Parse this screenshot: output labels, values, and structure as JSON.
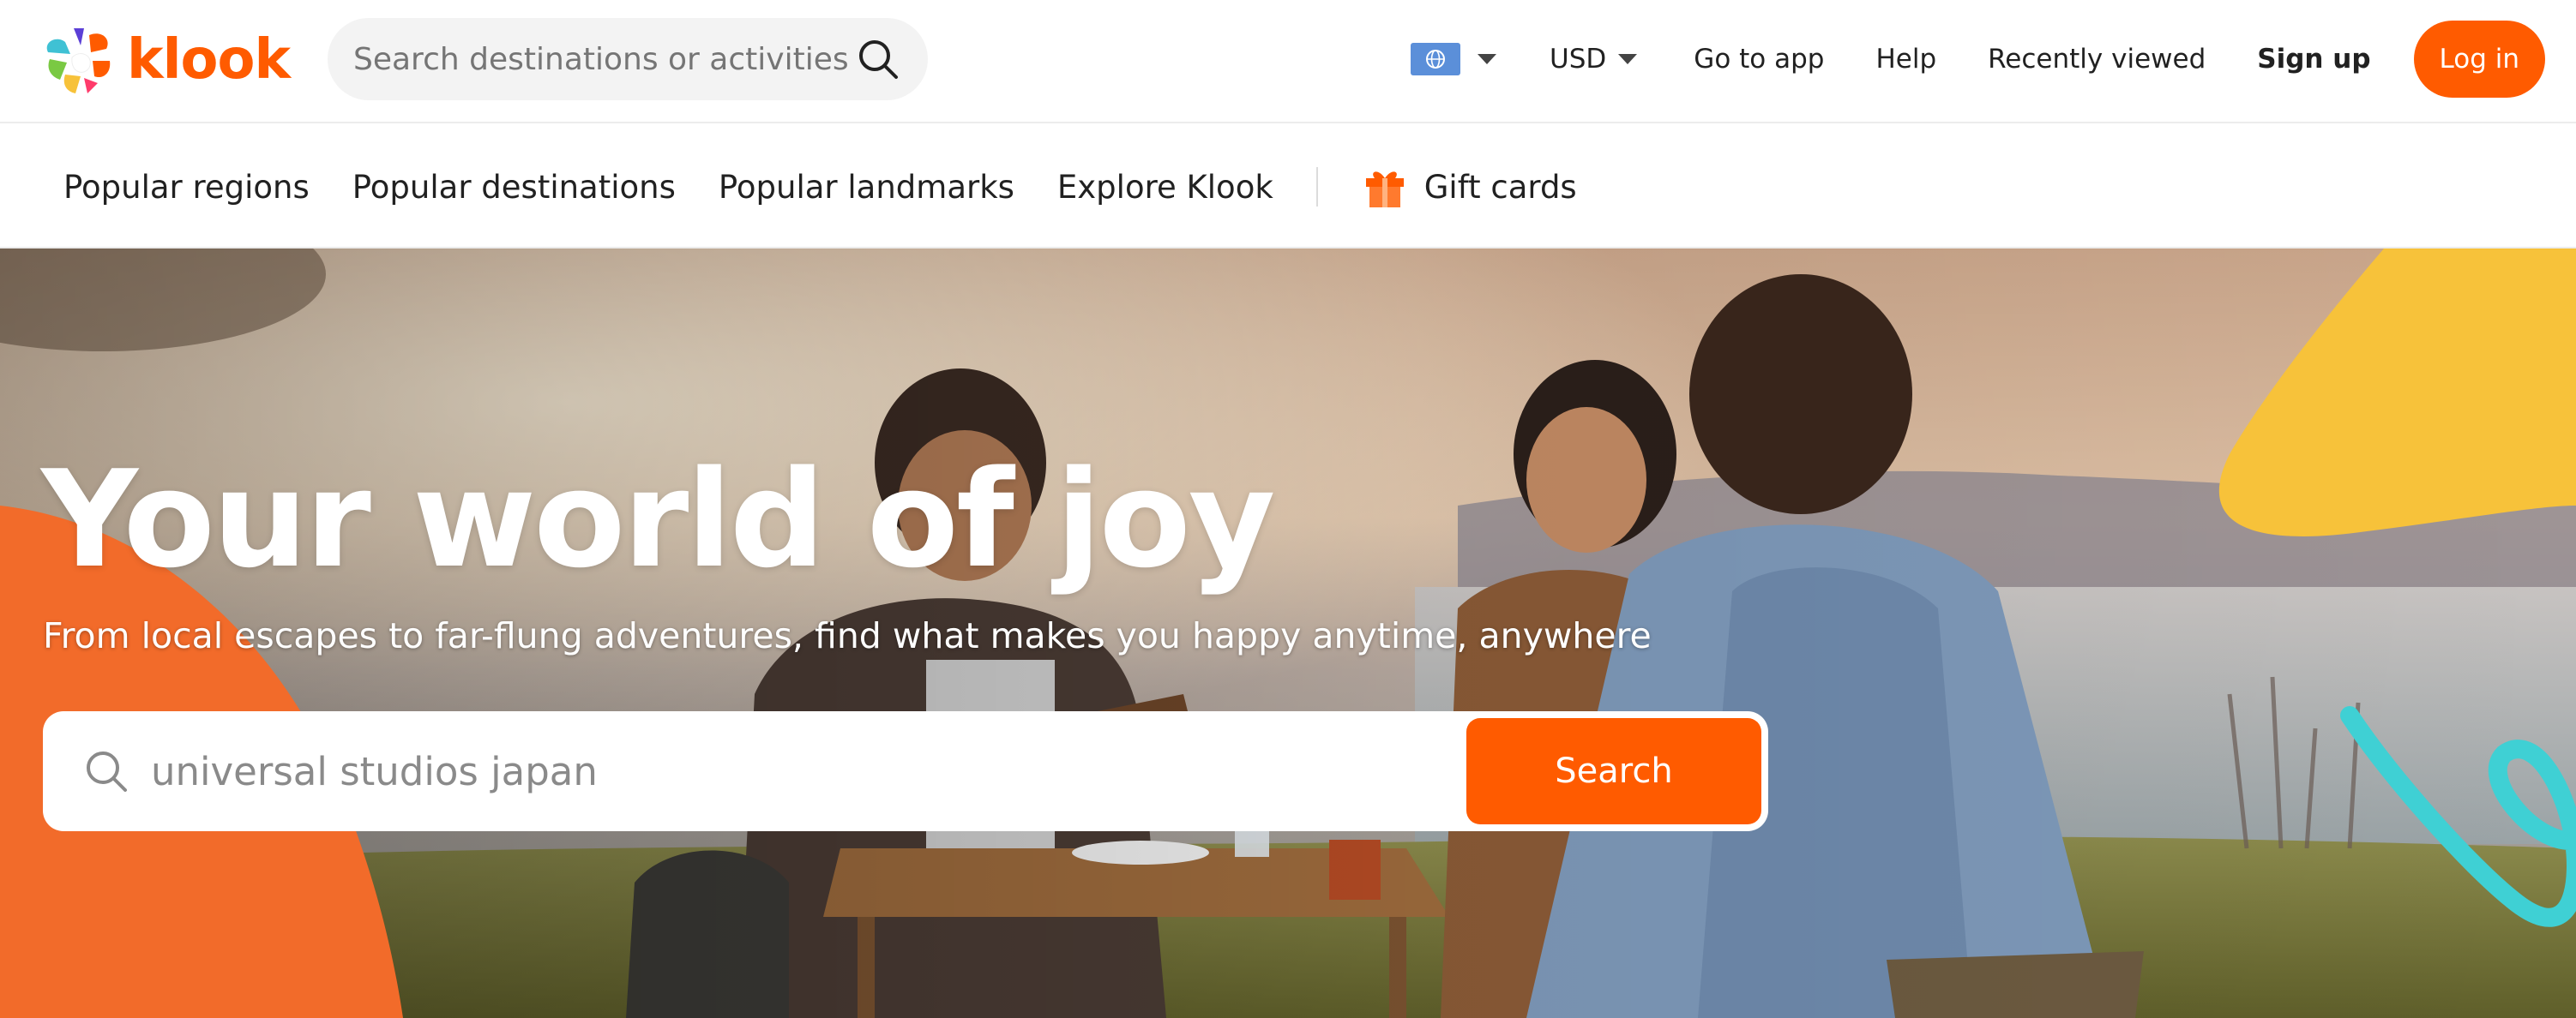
{
  "brand": {
    "name": "klook",
    "accent_color": "#ff5b00"
  },
  "header": {
    "search_placeholder": "Search destinations or activities",
    "language_icon": "globe-flag-icon",
    "currency": "USD",
    "links": {
      "go_to_app": "Go to app",
      "help": "Help",
      "recently_viewed": "Recently viewed",
      "sign_up": "Sign up"
    },
    "login_label": "Log in"
  },
  "subnav": {
    "items": [
      "Popular regions",
      "Popular destinations",
      "Popular landmarks",
      "Explore Klook"
    ],
    "gift_cards": "Gift cards"
  },
  "hero": {
    "title": "Your world of joy",
    "subtitle": "From local escapes to far-flung adventures, find what makes you happy anytime, anywhere",
    "search_placeholder": "universal studios japan",
    "search_button": "Search",
    "decor_colors": {
      "orange": "#f26b2a",
      "yellow": "#f7c23a",
      "teal": "#3fd0d4"
    }
  }
}
